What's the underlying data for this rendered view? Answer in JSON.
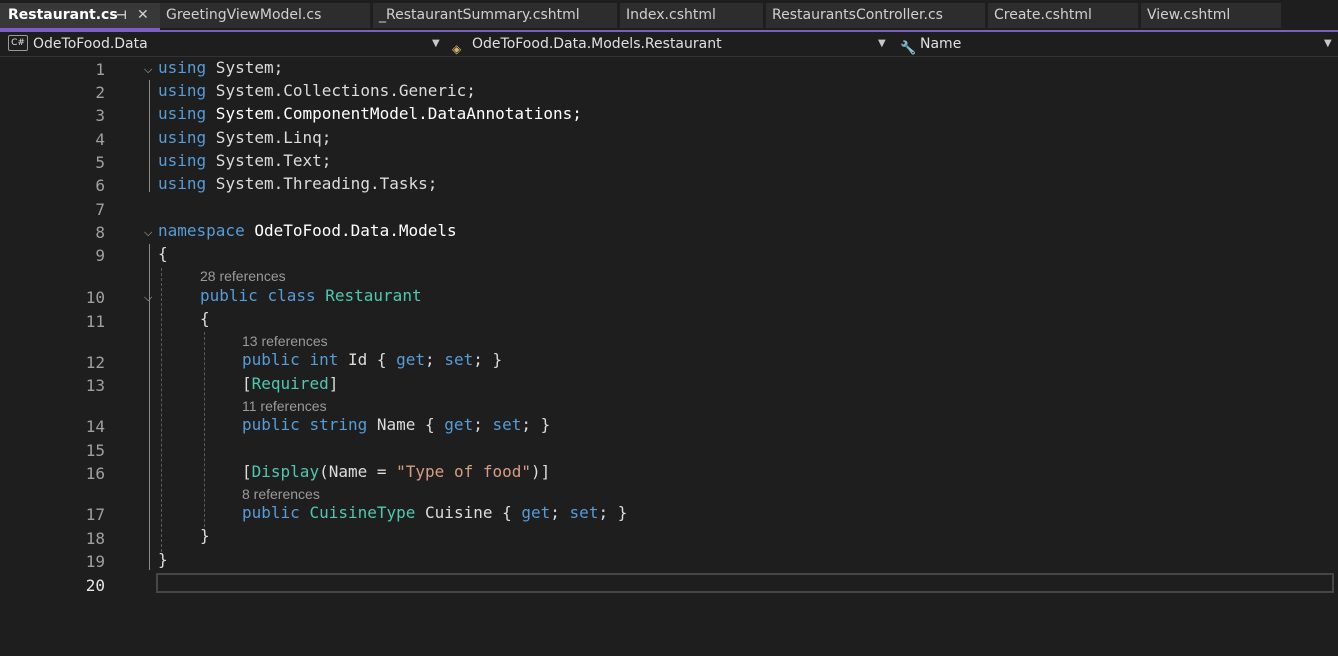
{
  "tabs": [
    {
      "label": "Restaurant.cs",
      "active": true
    },
    {
      "label": "GreetingViewModel.cs"
    },
    {
      "label": "_RestaurantSummary.cshtml"
    },
    {
      "label": "Index.cshtml"
    },
    {
      "label": "RestaurantsController.cs"
    },
    {
      "label": "Create.cshtml"
    },
    {
      "label": "View.cshtml"
    }
  ],
  "tab_icons": {
    "pin": "⊣",
    "close": "✕"
  },
  "navbar": {
    "project": "OdeToFood.Data",
    "project_badge": "C#",
    "type": "OdeToFood.Data.Models.Restaurant",
    "member": "Name"
  },
  "editor": {
    "line_numbers": [
      "1",
      "2",
      "3",
      "4",
      "5",
      "6",
      "7",
      "8",
      "9",
      "10",
      "11",
      "12",
      "13",
      "14",
      "15",
      "16",
      "17",
      "18",
      "19",
      "20"
    ],
    "references": {
      "class": "28 references",
      "id": "13 references",
      "name": "11 references",
      "cuisine": "8 references"
    },
    "code": {
      "l1": [
        "using",
        " System;"
      ],
      "l2": [
        "using",
        " System",
        ".",
        "Collections",
        ".",
        "Generic",
        ";"
      ],
      "l3": [
        "using",
        " System.ComponentModel.DataAnnotations;"
      ],
      "l4": [
        "using",
        " System",
        ".",
        "Linq",
        ";"
      ],
      "l5": [
        "using",
        " System",
        ".",
        "Text",
        ";"
      ],
      "l6": [
        "using",
        " System",
        ".",
        "Threading",
        ".",
        "Tasks",
        ";"
      ],
      "l8": [
        "namespace",
        " OdeToFood.Data.Models"
      ],
      "l9": "{",
      "l10": [
        "public",
        " ",
        "class",
        " ",
        "Restaurant"
      ],
      "l11": "{",
      "l12": [
        "public",
        " ",
        "int",
        " Id { ",
        "get",
        "; ",
        "set",
        "; }"
      ],
      "l13": [
        "[",
        "Required",
        "]"
      ],
      "l14": [
        "public",
        " ",
        "string",
        " Name { ",
        "get",
        "; ",
        "set",
        "; }"
      ],
      "l16": [
        "[",
        "Display",
        "(Name = ",
        "\"Type of food\"",
        ")]"
      ],
      "l17": [
        "public",
        " ",
        "CuisineType",
        " Cuisine { ",
        "get",
        "; ",
        "set",
        "; }"
      ],
      "l18": "}",
      "l19": "}"
    }
  },
  "colors": {
    "keyword": "#569cd6",
    "type": "#4ec9b0",
    "string": "#d69d85",
    "accent": "#7a5fc0"
  }
}
